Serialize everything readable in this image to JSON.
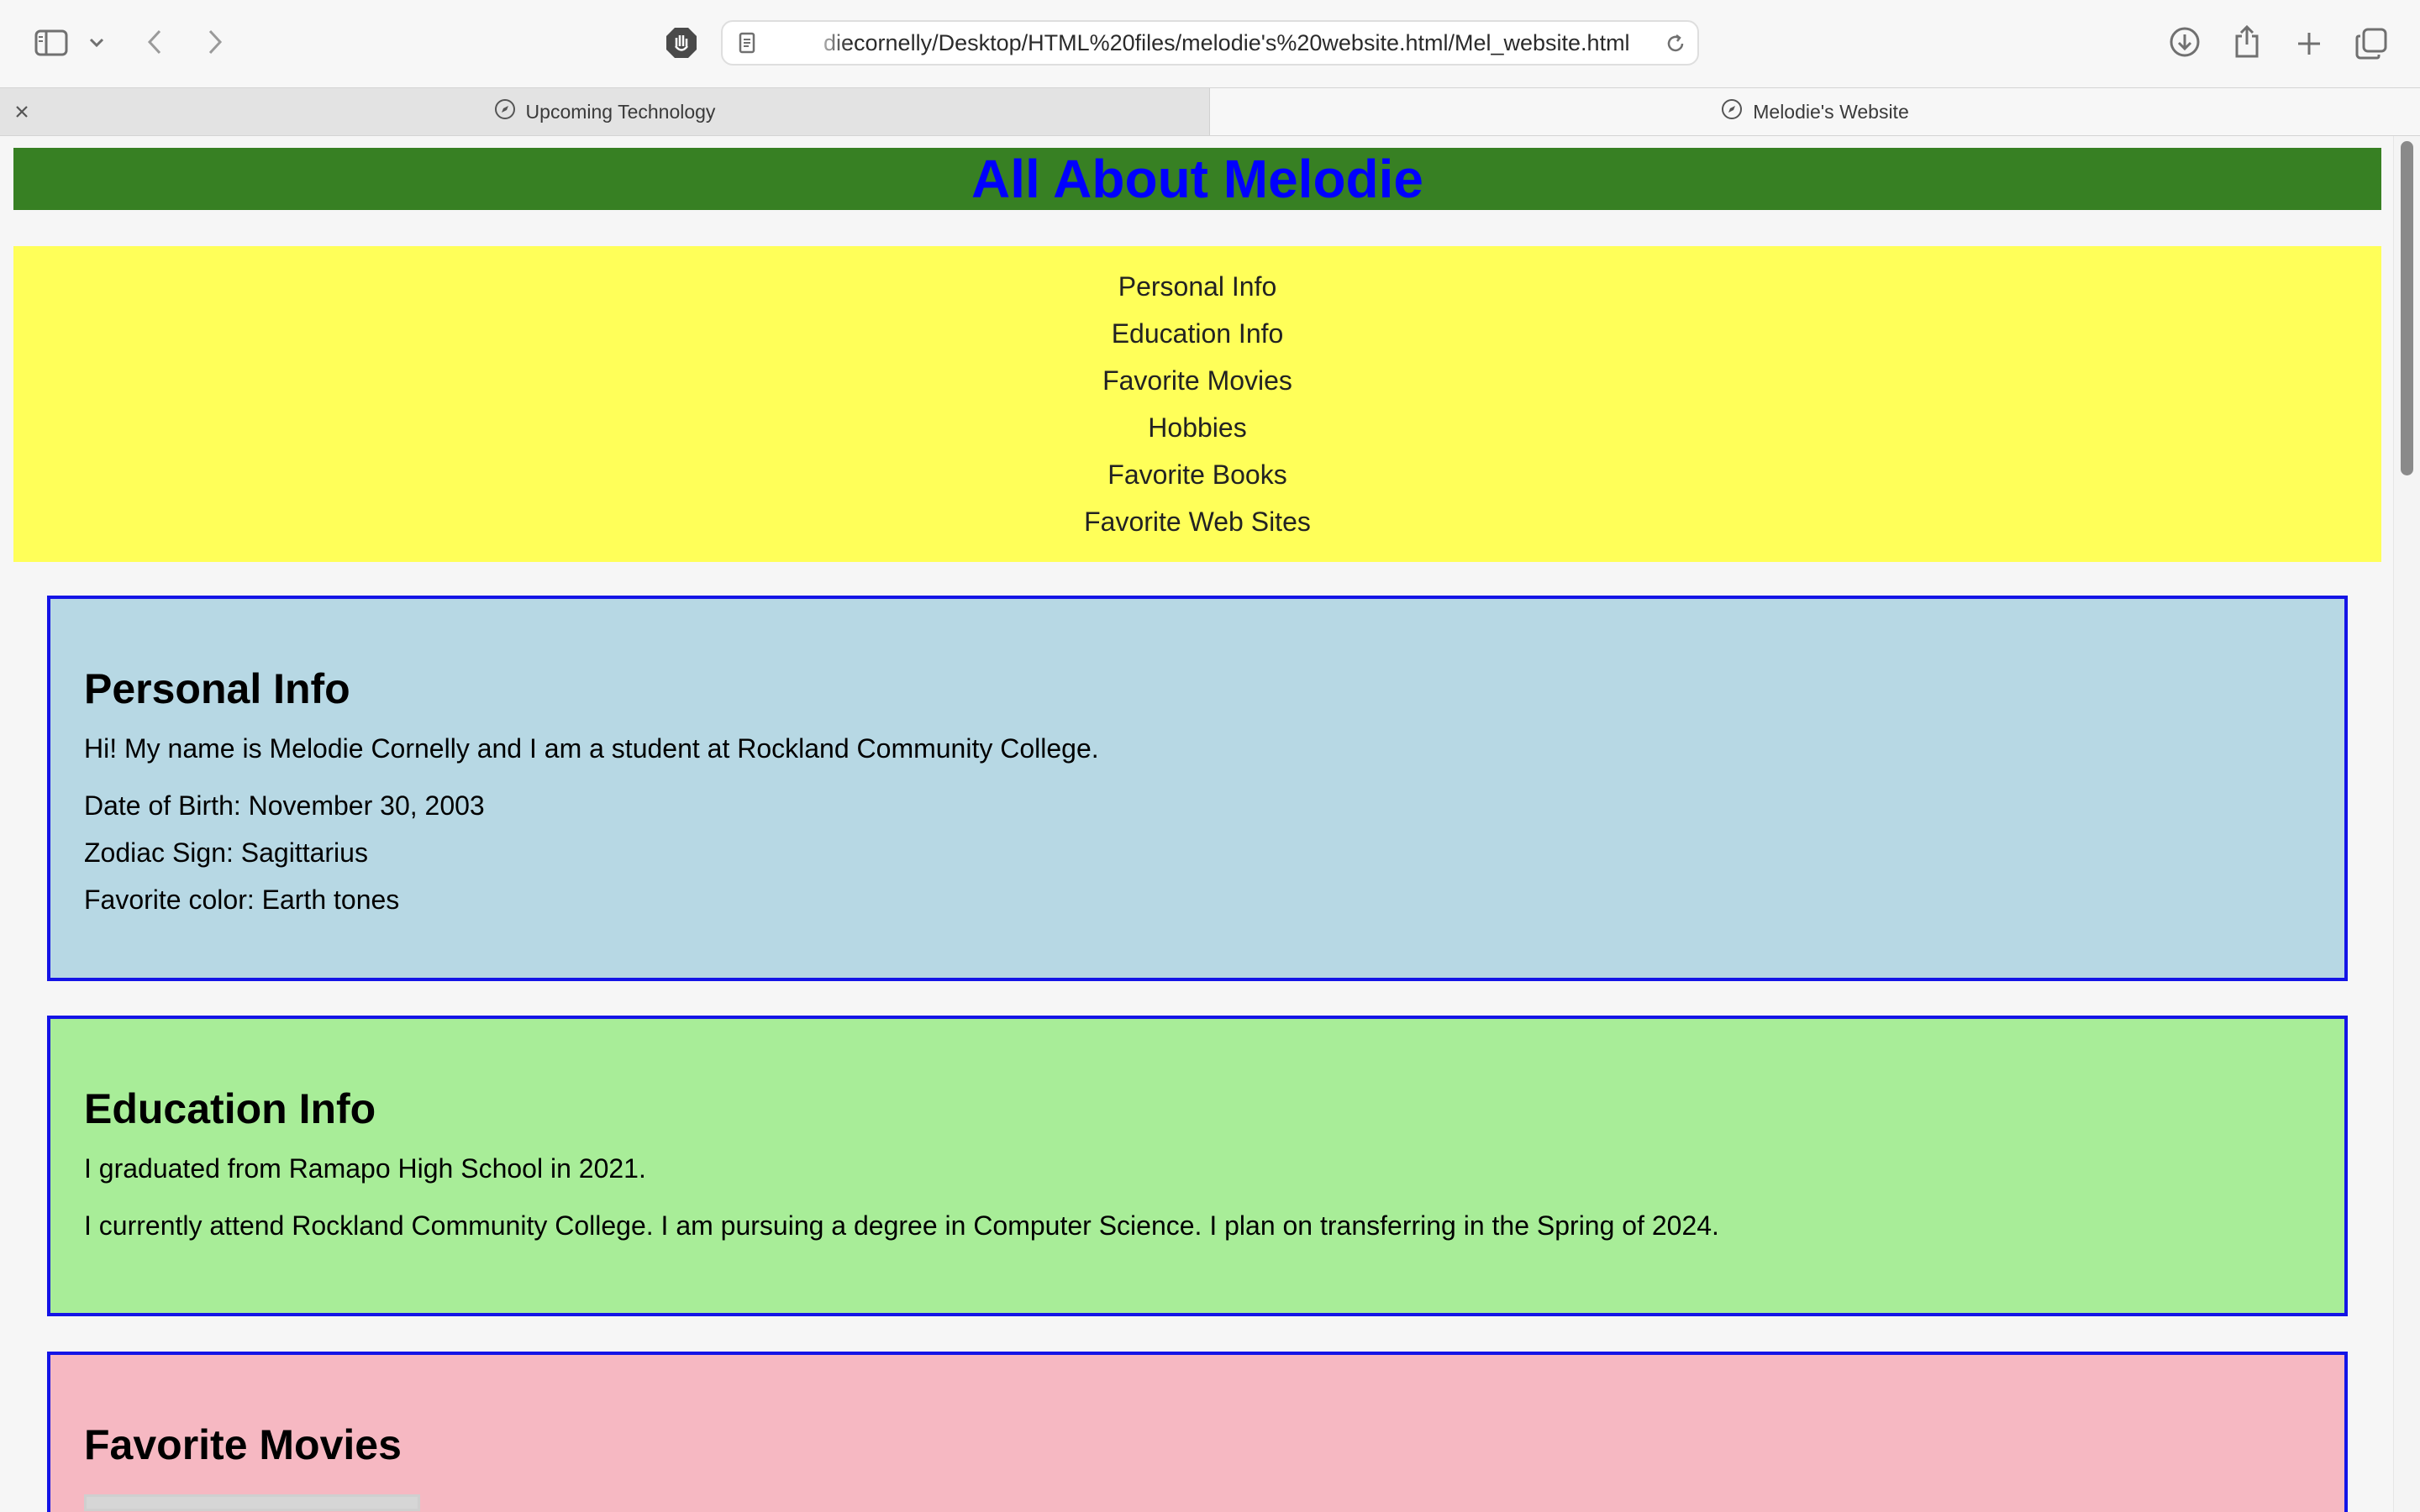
{
  "browser": {
    "url": "diecornelly/Desktop/HTML%20files/melodie's%20website.html/Mel_website.html",
    "tabs": [
      {
        "label": "Upcoming Technology"
      },
      {
        "label": "Melodie's Website"
      }
    ]
  },
  "page": {
    "title": "All About Melodie",
    "nav": [
      "Personal Info",
      "Education Info",
      "Favorite Movies",
      "Hobbies",
      "Favorite Books",
      "Favorite Web Sites"
    ],
    "personal": {
      "heading": "Personal Info",
      "intro": "Hi! My name is Melodie Cornelly and I am a student at Rockland Community College.",
      "dob": "Date of Birth: November 30, 2003",
      "zodiac": "Zodiac Sign: Sagittarius",
      "color": "Favorite color: Earth tones"
    },
    "education": {
      "heading": "Education Info",
      "line1": "I graduated from Ramapo High School in 2021.",
      "line2": "I currently attend Rockland Community College. I am pursuing a degree in Computer Science. I plan on transferring in the Spring of 2024."
    },
    "movies": {
      "heading": "Favorite Movies"
    }
  },
  "colors": {
    "header_bg": "#378023",
    "title_text": "#0000ff",
    "nav_bg": "#ffff59",
    "personal_bg": "#b7d8e4",
    "education_bg": "#a8ed98",
    "movies_bg": "#f6b8c2",
    "section_border": "#1414e6"
  }
}
